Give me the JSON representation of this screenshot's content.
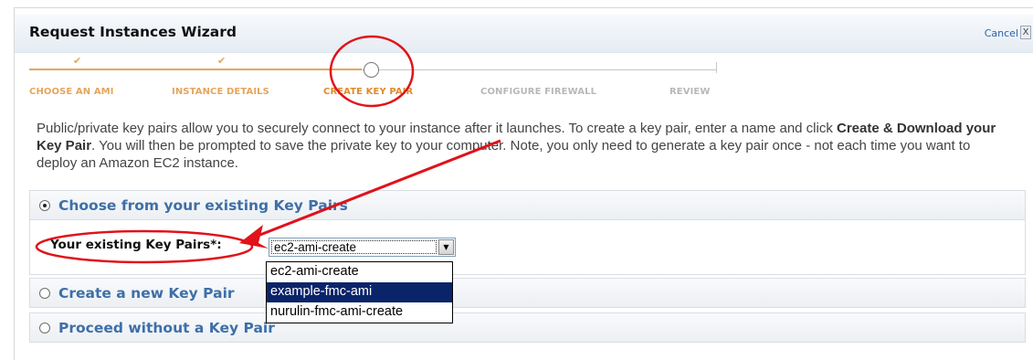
{
  "wizard": {
    "title": "Request Instances Wizard",
    "cancel_label": "Cancel",
    "close_glyph": "X"
  },
  "steps": [
    {
      "label": "CHOOSE AN AMI",
      "state": "done",
      "mark": "✔"
    },
    {
      "label": "INSTANCE DETAILS",
      "state": "done",
      "mark": "✔"
    },
    {
      "label": "CREATE KEY PAIR",
      "state": "current"
    },
    {
      "label": "CONFIGURE FIREWALL",
      "state": "future"
    },
    {
      "label": "REVIEW",
      "state": "future"
    }
  ],
  "intro": {
    "text_1": "Public/private key pairs allow you to securely connect to your instance after it launches. To create a key pair, enter a name and click ",
    "bold": "Create & Download your Key Pair",
    "text_2": ". You will then be prompted to save the private key to your computer. Note, you only need to generate a key pair once - not each time you want to deploy an Amazon EC2 instance."
  },
  "options": {
    "existing": {
      "title": "Choose from your existing Key Pairs",
      "selected": true,
      "field_label": "Your existing Key Pairs*:",
      "select_value": "ec2-ami-create",
      "select_options": [
        "ec2-ami-create",
        "example-fmc-ami",
        "nurulin-fmc-ami-create"
      ],
      "highlighted_option": "example-fmc-ami"
    },
    "create_new": {
      "title": "Create a new Key Pair",
      "selected": false
    },
    "proceed_without": {
      "title": "Proceed without a Key Pair",
      "selected": false
    }
  },
  "colors": {
    "accent_orange": "#e6a55c",
    "link_blue": "#3d6fa8",
    "annotation_red": "#e0121a",
    "highlight_navy": "#0a246a"
  }
}
